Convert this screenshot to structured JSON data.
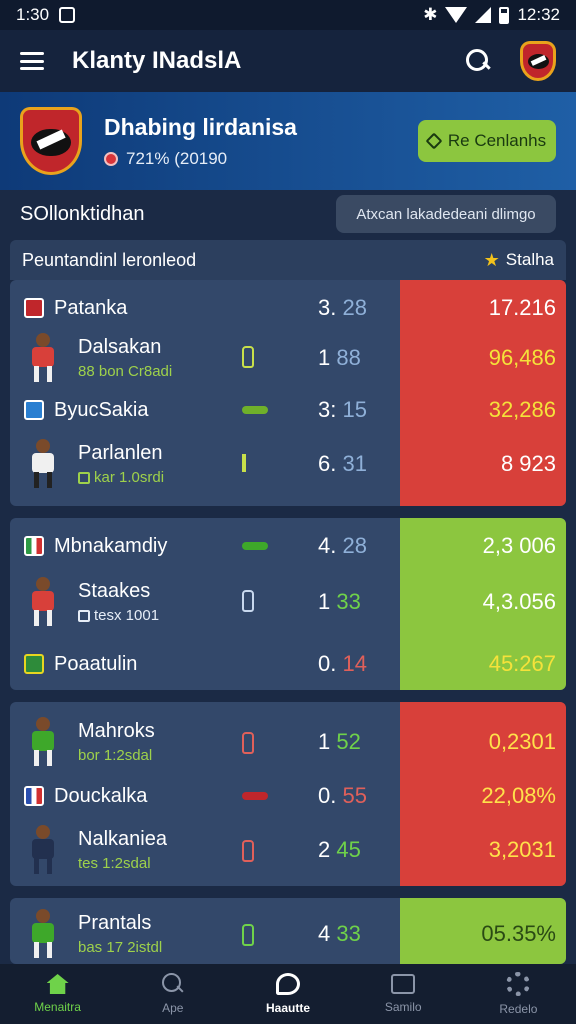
{
  "status": {
    "time": "1:30",
    "clock": "12:32"
  },
  "appbar": {
    "title": "Klanty INadslA",
    "search_icon": "search-icon",
    "logo_icon": "club-crest-icon"
  },
  "team": {
    "name": "Dhabing lirdanisa",
    "stat": "721% (20190",
    "follow_label": "Re Cenlanhs"
  },
  "section": {
    "title": "SOllonktidhan",
    "filter_label": "Atxcan lakadedeani dlimgo"
  },
  "list": {
    "header": "Peuntandinl leronleod",
    "header_right": "Stalha"
  },
  "cards": [
    {
      "panel_color": "#d8403a",
      "rows": [
        {
          "name": "Patanka",
          "sub": "",
          "score_a": "3.",
          "score_b": "28",
          "value": "17.216"
        },
        {
          "name": "Dalsakan",
          "sub": "88 bon Cr8adi",
          "score_a": "1",
          "score_b": "88",
          "value": "96,486"
        },
        {
          "name": "ByucSakia",
          "sub": "",
          "score_a": "3:",
          "score_b": "15",
          "value": "32,286"
        },
        {
          "name": "Parlanlen",
          "sub": "kar 1.0srdi",
          "score_a": "6.",
          "score_b": "31",
          "value": "8 923"
        }
      ]
    },
    {
      "panel_color": "#8cc63f",
      "rows": [
        {
          "name": "Mbnakamdiy",
          "sub": "",
          "score_a": "4.",
          "score_b": "28",
          "value": "2,3 006"
        },
        {
          "name": "Staakes",
          "sub": "tesx 1001",
          "score_a": "1",
          "score_b": "33",
          "value": "4,3.056"
        },
        {
          "name": "Poaatulin",
          "sub": "",
          "score_a": "0.",
          "score_b": "14",
          "value": "45:267"
        }
      ]
    },
    {
      "panel_color": "#d8403a",
      "rows": [
        {
          "name": "Mahroks",
          "sub": "bor 1:2sdal",
          "score_a": "1",
          "score_b": "52",
          "value": "0,2301"
        },
        {
          "name": "Douckalka",
          "sub": "",
          "score_a": "0.",
          "score_b": "55",
          "value": "22,08%"
        },
        {
          "name": "Nalkaniea",
          "sub": "tes 1:2sdal",
          "score_a": "2",
          "score_b": "45",
          "value": "3,2031"
        }
      ]
    },
    {
      "panel_color": "#8cc63f",
      "rows": [
        {
          "name": "Prantals",
          "sub": "bas 17 2istdl",
          "score_a": "4",
          "score_b": "33",
          "value": "05.35%"
        }
      ]
    }
  ],
  "nav": [
    {
      "label": "Menaitra",
      "icon": "home-icon"
    },
    {
      "label": "Ape",
      "icon": "search-icon"
    },
    {
      "label": "Haautte",
      "icon": "chat-icon"
    },
    {
      "label": "Samilo",
      "icon": "mail-icon"
    },
    {
      "label": "Redelo",
      "icon": "gear-icon"
    }
  ]
}
